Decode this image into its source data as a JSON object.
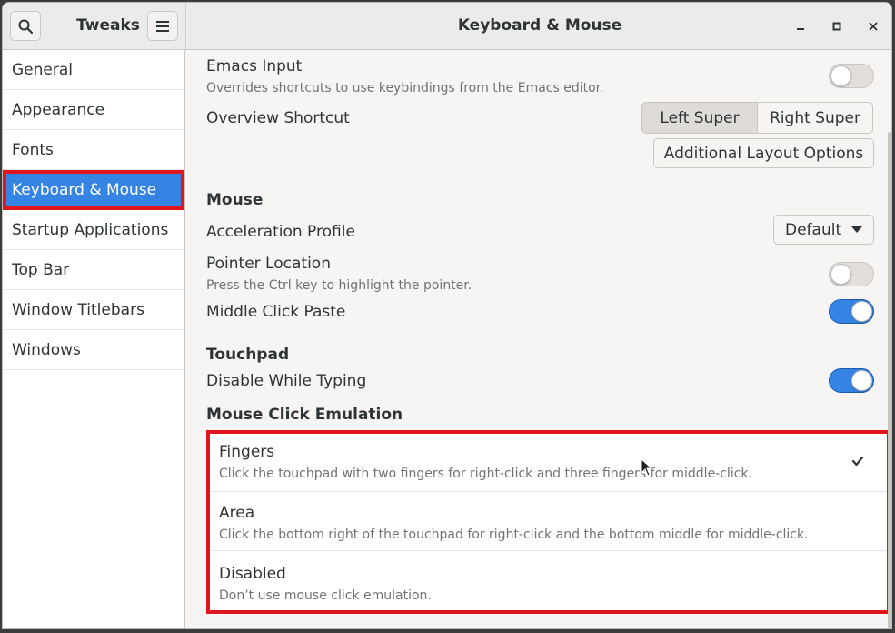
{
  "header": {
    "app_title": "Tweaks",
    "page_title": "Keyboard & Mouse"
  },
  "sidebar": {
    "items": [
      {
        "label": "General"
      },
      {
        "label": "Appearance"
      },
      {
        "label": "Fonts"
      },
      {
        "label": "Keyboard & Mouse",
        "selected": true
      },
      {
        "label": "Startup Applications"
      },
      {
        "label": "Top Bar"
      },
      {
        "label": "Window Titlebars"
      },
      {
        "label": "Windows"
      }
    ]
  },
  "keyboard": {
    "emacs_input": {
      "label": "Emacs Input",
      "description": "Overrides shortcuts to use keybindings from the Emacs editor.",
      "enabled": false
    },
    "overview_shortcut": {
      "label": "Overview Shortcut",
      "options": [
        "Left Super",
        "Right Super"
      ],
      "selected": "Left Super"
    },
    "additional_layout_button": "Additional Layout Options"
  },
  "mouse": {
    "section_title": "Mouse",
    "acceleration_profile": {
      "label": "Acceleration Profile",
      "value": "Default"
    },
    "pointer_location": {
      "label": "Pointer Location",
      "description": "Press the Ctrl key to highlight the pointer.",
      "enabled": false
    },
    "middle_click_paste": {
      "label": "Middle Click Paste",
      "enabled": true
    }
  },
  "touchpad": {
    "section_title": "Touchpad",
    "disable_while_typing": {
      "label": "Disable While Typing",
      "enabled": true
    }
  },
  "click_emulation": {
    "section_title": "Mouse Click Emulation",
    "selected": "Fingers",
    "options": [
      {
        "title": "Fingers",
        "description": "Click the touchpad with two fingers for right-click and three fingers for middle-click.",
        "checked": true
      },
      {
        "title": "Area",
        "description": "Click the bottom right of the touchpad for right-click and the bottom middle for middle-click.",
        "checked": false
      },
      {
        "title": "Disabled",
        "description": "Don’t use mouse click emulation.",
        "checked": false
      }
    ]
  },
  "colors": {
    "accent": "#3584e4",
    "highlight_border": "#e0161f"
  }
}
